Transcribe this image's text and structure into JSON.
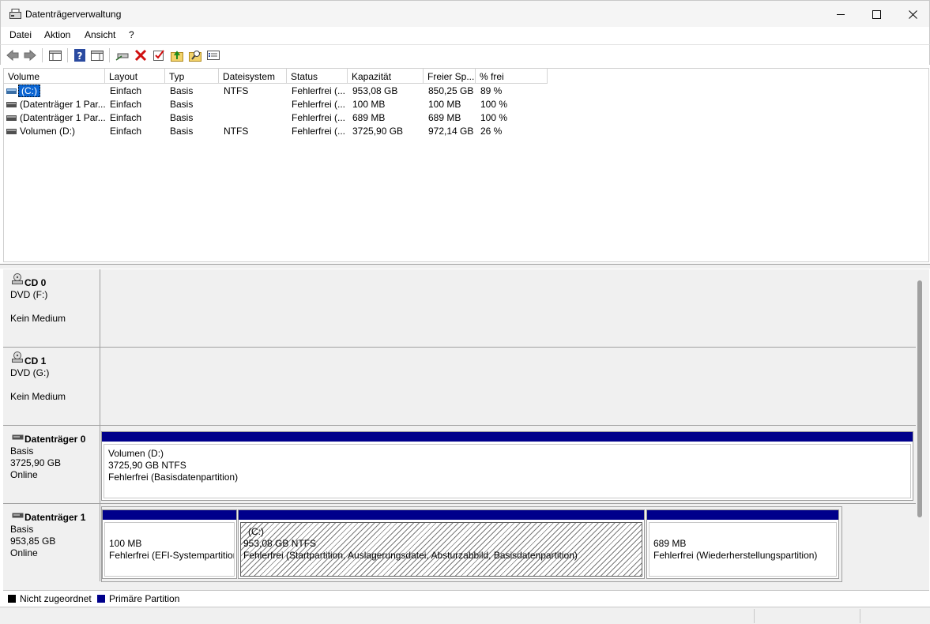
{
  "window": {
    "title": "Datenträgerverwaltung",
    "minimize_glyph": "—",
    "maximize_glyph": "☐",
    "close_glyph": "✕"
  },
  "menu": [
    "Datei",
    "Aktion",
    "Ansicht",
    "?"
  ],
  "toolbar": {
    "icons": [
      "back-icon",
      "forward-icon",
      "console-tree-icon",
      "help-icon",
      "properties-pane-icon",
      "connect-disk-icon",
      "delete-icon",
      "check-icon",
      "folder-up-icon",
      "folder-search-icon",
      "settings-list-icon"
    ]
  },
  "volume_list": {
    "columns": [
      "Volume",
      "Layout",
      "Typ",
      "Dateisystem",
      "Status",
      "Kapazität",
      "Freier Sp...",
      "% frei"
    ],
    "rows": [
      {
        "volume": "(C:)",
        "layout": "Einfach",
        "typ": "Basis",
        "dateisystem": "NTFS",
        "status": "Fehlerfrei (...",
        "kapazitaet": "953,08 GB",
        "frei": "850,25 GB",
        "prozent": "89 %",
        "selected": true
      },
      {
        "volume": "(Datenträger 1 Par...",
        "layout": "Einfach",
        "typ": "Basis",
        "dateisystem": "",
        "status": "Fehlerfrei (...",
        "kapazitaet": "100 MB",
        "frei": "100 MB",
        "prozent": "100 %"
      },
      {
        "volume": "(Datenträger 1 Par...",
        "layout": "Einfach",
        "typ": "Basis",
        "dateisystem": "",
        "status": "Fehlerfrei (...",
        "kapazitaet": "689 MB",
        "frei": "689 MB",
        "prozent": "100 %"
      },
      {
        "volume": "Volumen (D:)",
        "layout": "Einfach",
        "typ": "Basis",
        "dateisystem": "NTFS",
        "status": "Fehlerfrei (...",
        "kapazitaet": "3725,90 GB",
        "frei": "972,14 GB",
        "prozent": "26 %"
      }
    ]
  },
  "disks": {
    "cd0": {
      "name": "CD 0",
      "type": "DVD (F:)",
      "state": "Kein Medium"
    },
    "cd1": {
      "name": "CD 1",
      "type": "DVD (G:)",
      "state": "Kein Medium"
    },
    "disk0": {
      "name": "Datenträger 0",
      "type": "Basis",
      "size": "3725,90 GB",
      "state": "Online",
      "partitions": [
        {
          "title": "Volumen  (D:)",
          "size": "3725,90 GB NTFS",
          "status": "Fehlerfrei (Basisdatenpartition)"
        }
      ]
    },
    "disk1": {
      "name": "Datenträger 1",
      "type": "Basis",
      "size": "953,85 GB",
      "state": "Online",
      "partitions": [
        {
          "size": "100 MB",
          "status": "Fehlerfrei (EFI-Systempartition"
        },
        {
          "title": "(C:)",
          "size": "953,08 GB NTFS",
          "status": "Fehlerfrei (Startpartition, Auslagerungsdatei, Absturzabbild, Basisdatenpartition)"
        },
        {
          "size": "689 MB",
          "status": "Fehlerfrei (Wiederherstellungspartition)"
        }
      ]
    }
  },
  "legend": [
    {
      "label": "Nicht zugeordnet",
      "color": "#000000"
    },
    {
      "label": "Primäre Partition",
      "color": "#00008b"
    }
  ],
  "colors": {
    "partition_bar": "#00008b",
    "selection": "#0a64d2"
  }
}
